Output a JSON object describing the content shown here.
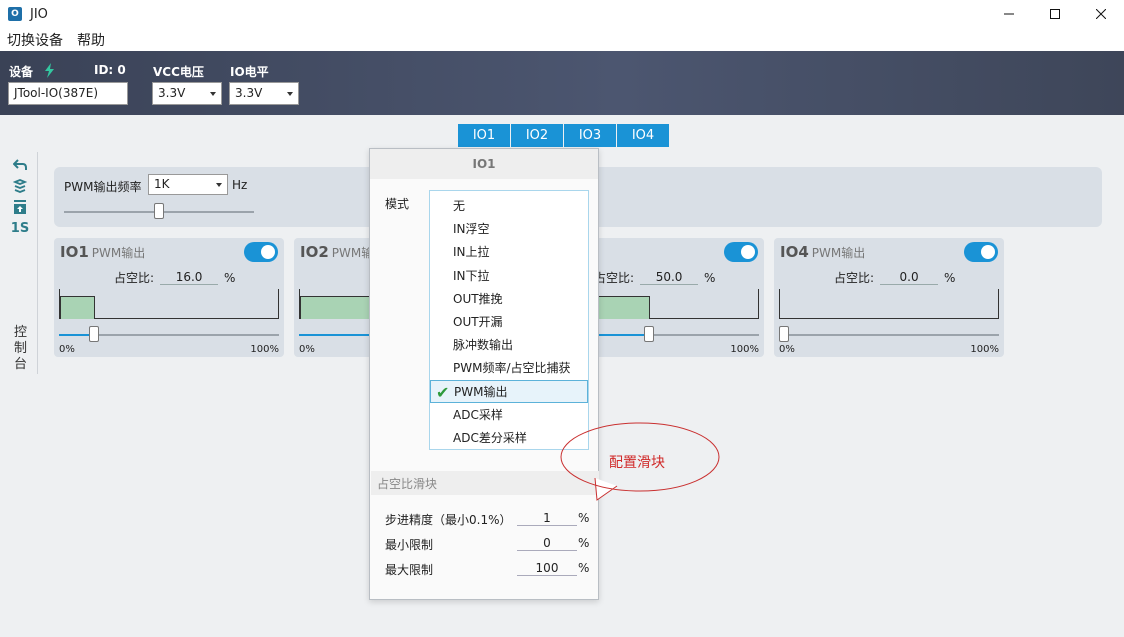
{
  "window": {
    "title": "JIO"
  },
  "menu": {
    "items": [
      "切换设备",
      "帮助"
    ]
  },
  "header": {
    "device_label": "设备",
    "id_text": "ID: 0",
    "vcc_label": "VCC电压",
    "io_label": "IO电平",
    "device_name": "JTool-IO(387E)",
    "vcc_value": "3.3V",
    "io_value": "3.3V"
  },
  "tabs": [
    "IO1",
    "IO2",
    "IO3",
    "IO4"
  ],
  "left_tools": {
    "sec_label": "1S",
    "console": "控制台"
  },
  "freq": {
    "label": "PWM输出频率",
    "value": "1K",
    "unit": "Hz",
    "slider_level_pct": 50
  },
  "duty_label": "占空比:",
  "pct_unit": "%",
  "range_min": "0%",
  "range_max": "100%",
  "io_cards": [
    {
      "name": "IO1",
      "mode": "PWM输出",
      "duty": "16.0",
      "duty_pct": 16
    },
    {
      "name": "IO2",
      "mode": "PWM输",
      "duty": "",
      "duty_pct": 38
    },
    {
      "name": "",
      "mode": "出",
      "duty": "50.0",
      "duty_pct": 50
    },
    {
      "name": "IO4",
      "mode": "PWM输出",
      "duty": "0.0",
      "duty_pct": 0
    }
  ],
  "popup": {
    "title": "IO1",
    "mode_label": "模式",
    "modes": [
      "无",
      "IN浮空",
      "IN上拉",
      "IN下拉",
      "OUT推挽",
      "OUT开漏",
      "脉冲数输出",
      "PWM频率/占空比捕获",
      "PWM输出",
      "ADC采样",
      "ADC差分采样"
    ],
    "selected_mode": "PWM输出",
    "section_title": "占空比滑块",
    "params": [
      {
        "label": "步进精度（最小0.1%）",
        "value": "1",
        "unit": "%"
      },
      {
        "label": "最小限制",
        "value": "0",
        "unit": "%"
      },
      {
        "label": "最大限制",
        "value": "100",
        "unit": "%"
      }
    ]
  },
  "callout": {
    "text": "配置滑块"
  },
  "colors": {
    "accent": "#1a93d6",
    "header_dark": "#3a4256",
    "wave_fill": "#a9d3b4",
    "callout_red": "#d02a2a"
  }
}
